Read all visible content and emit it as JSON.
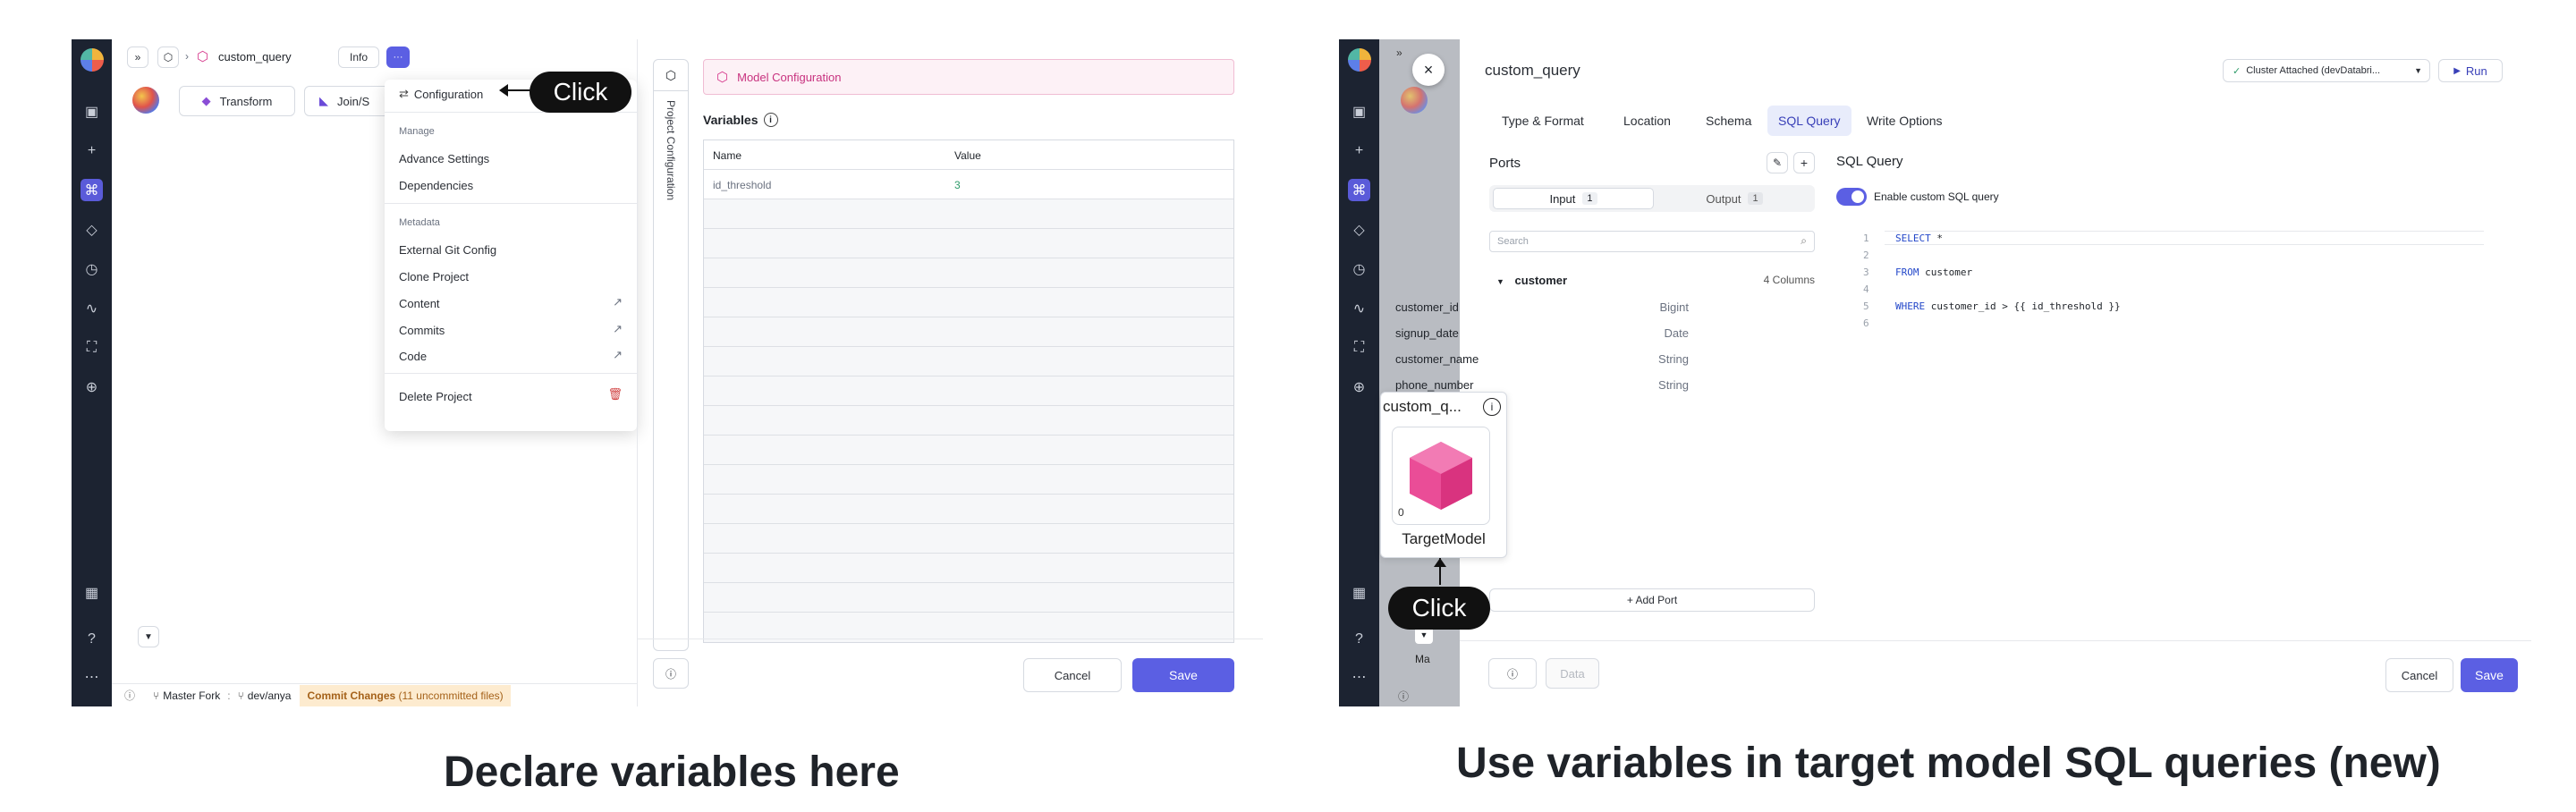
{
  "left": {
    "breadcrumb": {
      "project": "custom_query",
      "info_label": "Info",
      "more_label": "···"
    },
    "toolbar": {
      "transform_label": "Transform",
      "join_label": "Join/S"
    },
    "dropdown": {
      "configuration_label": "Configuration",
      "manage_header": "Manage",
      "advance_settings": "Advance Settings",
      "dependencies": "Dependencies",
      "metadata_header": "Metadata",
      "external_git": "External Git Config",
      "clone_project": "Clone Project",
      "content": "Content",
      "commits": "Commits",
      "code": "Code",
      "delete_project": "Delete Project"
    },
    "callout": "Click",
    "side_tab": "Project Configuration",
    "config": {
      "title": "Model Configuration",
      "variables_label": "Variables",
      "columns": [
        "Name",
        "Value"
      ],
      "rows": [
        {
          "name": "id_threshold",
          "value": "3"
        }
      ],
      "cancel_label": "Cancel",
      "save_label": "Save"
    },
    "footer": {
      "branch_label": "Master Fork",
      "separator": ":",
      "dev_branch": "dev/anya",
      "commit_label": "Commit Changes",
      "commit_detail": "(11 uncommitted files)"
    }
  },
  "right": {
    "close_label": "×",
    "title": "custom_query",
    "cluster_label": "Cluster Attached (devDatabri...",
    "run_label": "Run",
    "tabs": [
      "Type & Format",
      "Location",
      "Schema",
      "SQL Query",
      "Write Options"
    ],
    "active_tab": "SQL Query",
    "ports": {
      "title": "Ports",
      "input_label": "Input",
      "input_count": "1",
      "output_label": "Output",
      "output_count": "1",
      "search_placeholder": "Search",
      "table_name": "customer",
      "columns_count": "4 Columns",
      "columns": [
        {
          "name": "customer_id",
          "type": "Bigint"
        },
        {
          "name": "signup_date",
          "type": "Date"
        },
        {
          "name": "customer_name",
          "type": "String"
        },
        {
          "name": "phone_number",
          "type": "String"
        }
      ],
      "add_port_label": "+ Add Port"
    },
    "sql": {
      "title": "SQL Query",
      "toggle_label": "Enable custom SQL query",
      "toggle_on": true,
      "lines": [
        {
          "n": "1",
          "kw": "SELECT",
          "rest": " *"
        },
        {
          "n": "2",
          "kw": "",
          "rest": ""
        },
        {
          "n": "3",
          "kw": "FROM",
          "rest": " customer"
        },
        {
          "n": "4",
          "kw": "",
          "rest": ""
        },
        {
          "n": "5",
          "kw": "WHERE",
          "rest": " customer_id > {{ id_threshold }}"
        },
        {
          "n": "6",
          "kw": "",
          "rest": ""
        }
      ]
    },
    "node": {
      "title": "custom_q...",
      "label": "TargetModel",
      "count": "0"
    },
    "callout": "Click",
    "footer": {
      "data_label": "Data",
      "cancel_label": "Cancel",
      "save_label": "Save",
      "branch_partial": "Ma"
    }
  },
  "captions": {
    "left": "Declare variables here",
    "right": "Use variables in target model SQL queries (new)"
  }
}
